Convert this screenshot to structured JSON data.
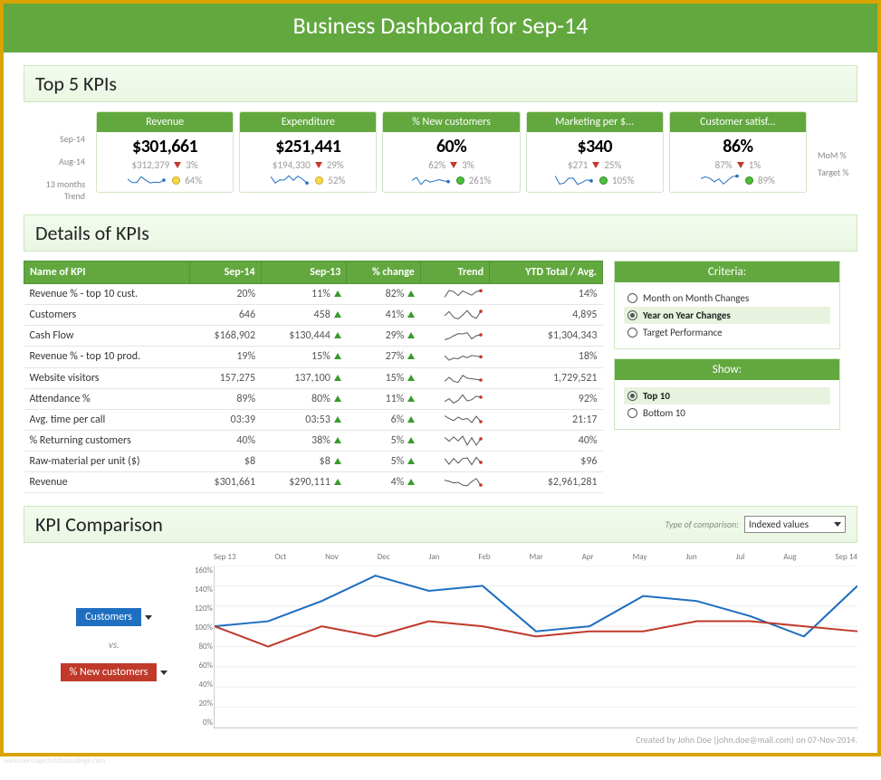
{
  "title": "Business Dashboard for Sep-14",
  "kpi_section_title": "Top 5 KPIs",
  "left_labels": {
    "l1": "Sep-14",
    "l2": "Aug-14",
    "l3": "13 months Trend"
  },
  "right_labels": {
    "r1": "MoM %",
    "r2": "Target %"
  },
  "cards": [
    {
      "title": "Revenue",
      "value": "$301,661",
      "prev": "$312,379",
      "mom": "3%",
      "target": "64%",
      "dot": "yellow"
    },
    {
      "title": "Expenditure",
      "value": "$251,441",
      "prev": "$194,330",
      "mom": "29%",
      "target": "52%",
      "dot": "yellow"
    },
    {
      "title": "% New customers",
      "value": "60%",
      "prev": "62%",
      "mom": "3%",
      "target": "261%",
      "dot": "green"
    },
    {
      "title": "Marketing per $...",
      "value": "$340",
      "prev": "$271",
      "mom": "25%",
      "target": "105%",
      "dot": "green"
    },
    {
      "title": "Customer satisf...",
      "value": "86%",
      "prev": "87%",
      "mom": "1%",
      "target": "89%",
      "dot": "green"
    }
  ],
  "details_title": "Details of KPIs",
  "table_headers": [
    "Name of KPI",
    "Sep-14",
    "Sep-13",
    "% change",
    "Trend",
    "YTD Total / Avg."
  ],
  "table_rows": [
    {
      "name": "Revenue % - top 10 cust.",
      "a": "20%",
      "b": "11%",
      "pct": "82%",
      "ytd": "14%"
    },
    {
      "name": "Customers",
      "a": "646",
      "b": "458",
      "pct": "41%",
      "ytd": "4,895"
    },
    {
      "name": "Cash Flow",
      "a": "$168,902",
      "b": "$130,444",
      "pct": "29%",
      "ytd": "$1,304,343"
    },
    {
      "name": "Revenue % - top 10 prod.",
      "a": "19%",
      "b": "15%",
      "pct": "27%",
      "ytd": "18%"
    },
    {
      "name": "Website visitors",
      "a": "157,275",
      "b": "137,100",
      "pct": "15%",
      "ytd": "1,729,521"
    },
    {
      "name": "Attendance %",
      "a": "89%",
      "b": "80%",
      "pct": "11%",
      "ytd": "92%"
    },
    {
      "name": "Avg. time per call",
      "a": "03:39",
      "b": "03:53",
      "pct": "6%",
      "ytd": "21:17"
    },
    {
      "name": "% Returning customers",
      "a": "40%",
      "b": "38%",
      "pct": "5%",
      "ytd": "40%"
    },
    {
      "name": "Raw-material per unit ($)",
      "a": "$8",
      "b": "$8",
      "pct": "5%",
      "ytd": "$96"
    },
    {
      "name": "Revenue",
      "a": "$301,661",
      "b": "$290,111",
      "pct": "4%",
      "ytd": "$2,961,281"
    }
  ],
  "criteria": {
    "title": "Criteria:",
    "options": [
      "Month on Month Changes",
      "Year on Year Changes",
      "Target Performance"
    ],
    "selected": 1
  },
  "show": {
    "title": "Show:",
    "options": [
      "Top 10",
      "Bottom 10"
    ],
    "selected": 0
  },
  "comparison": {
    "title": "KPI Comparison",
    "type_label": "Type of comparison:",
    "type_value": "Indexed values",
    "series_a": "Customers",
    "vs": "vs.",
    "series_b": "% New customers"
  },
  "chart_data": {
    "type": "line",
    "title": "KPI Comparison — Indexed values",
    "xlabel": "",
    "ylabel": "",
    "ylim": [
      0,
      160
    ],
    "y_ticks": [
      "0%",
      "20%",
      "40%",
      "60%",
      "80%",
      "100%",
      "120%",
      "140%",
      "160%"
    ],
    "categories": [
      "Sep 13",
      "Oct",
      "Nov",
      "Dec",
      "Jan",
      "Feb",
      "Mar",
      "Apr",
      "May",
      "Jun",
      "Jul",
      "Aug",
      "Sep 14"
    ],
    "series": [
      {
        "name": "Customers",
        "color": "#1f6fc0",
        "values": [
          100,
          105,
          125,
          150,
          135,
          140,
          95,
          100,
          130,
          125,
          110,
          90,
          140
        ]
      },
      {
        "name": "% New customers",
        "color": "#c0392b",
        "values": [
          100,
          80,
          100,
          90,
          105,
          100,
          90,
          95,
          95,
          105,
          105,
          100,
          95
        ]
      }
    ]
  },
  "footer": "Created by John Doe (john.doe@mail.com) on 07-Nov-2014.",
  "watermark": "www.heritagechristiancollege.com"
}
